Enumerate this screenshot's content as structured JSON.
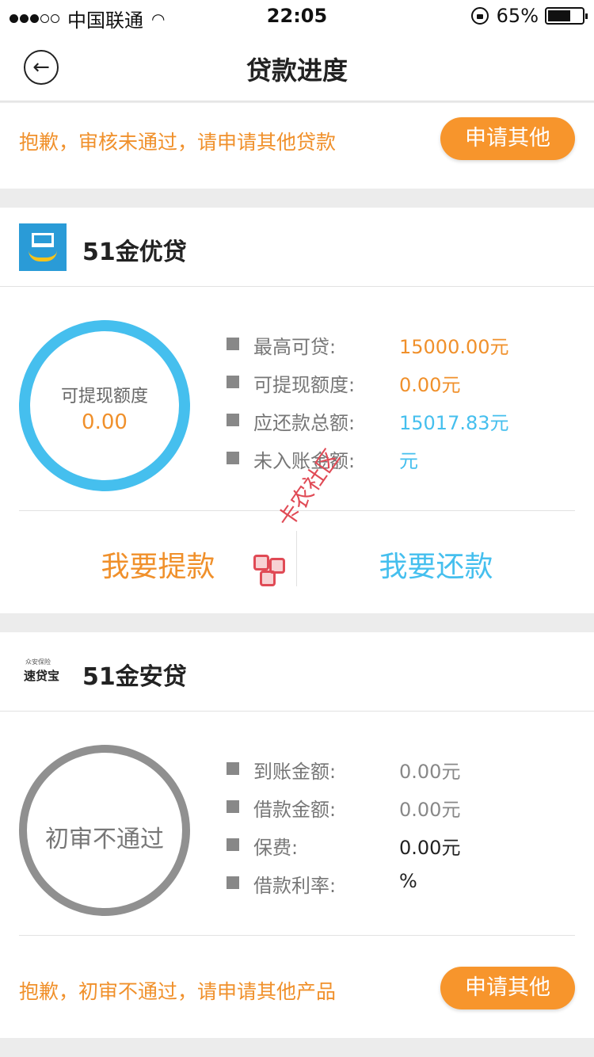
{
  "status_bar": {
    "carrier": "中国联通",
    "time": "22:05",
    "battery": "65%"
  },
  "nav": {
    "title": "贷款进度"
  },
  "notice_top": {
    "text": "抱歉，审核未通过，请申请其他贷款",
    "button": "申请其他"
  },
  "card1": {
    "name": "51金优贷",
    "ring_label": "可提现额度",
    "ring_value": "0.00",
    "rows": [
      {
        "label": "最高可贷:",
        "value": "15000.00元"
      },
      {
        "label": "可提现额度:",
        "value": "0.00元"
      },
      {
        "label": "应还款总额:",
        "value": "15017.83元"
      },
      {
        "label": "未入账金额:",
        "value": "元"
      }
    ],
    "withdraw": "我要提款",
    "repay": "我要还款"
  },
  "watermark": {
    "text": "卡农社区"
  },
  "card2": {
    "name": "51金安贷",
    "logo_small": "众安保险",
    "logo_big": "速贷宝",
    "ring_status": "初审不通过",
    "rows": [
      {
        "label": "到账金额:",
        "value": "0.00元"
      },
      {
        "label": "借款金额:",
        "value": "0.00元"
      },
      {
        "label": "保费:",
        "value": "0.00元"
      },
      {
        "label": "借款利率:",
        "value": "%"
      }
    ],
    "notice": "抱歉，初审不通过，请申请其他产品",
    "button": "申请其他"
  },
  "colors": {
    "accent_orange": "#f7952c",
    "ring_blue": "#45bfee",
    "ring_gray": "#909090"
  }
}
